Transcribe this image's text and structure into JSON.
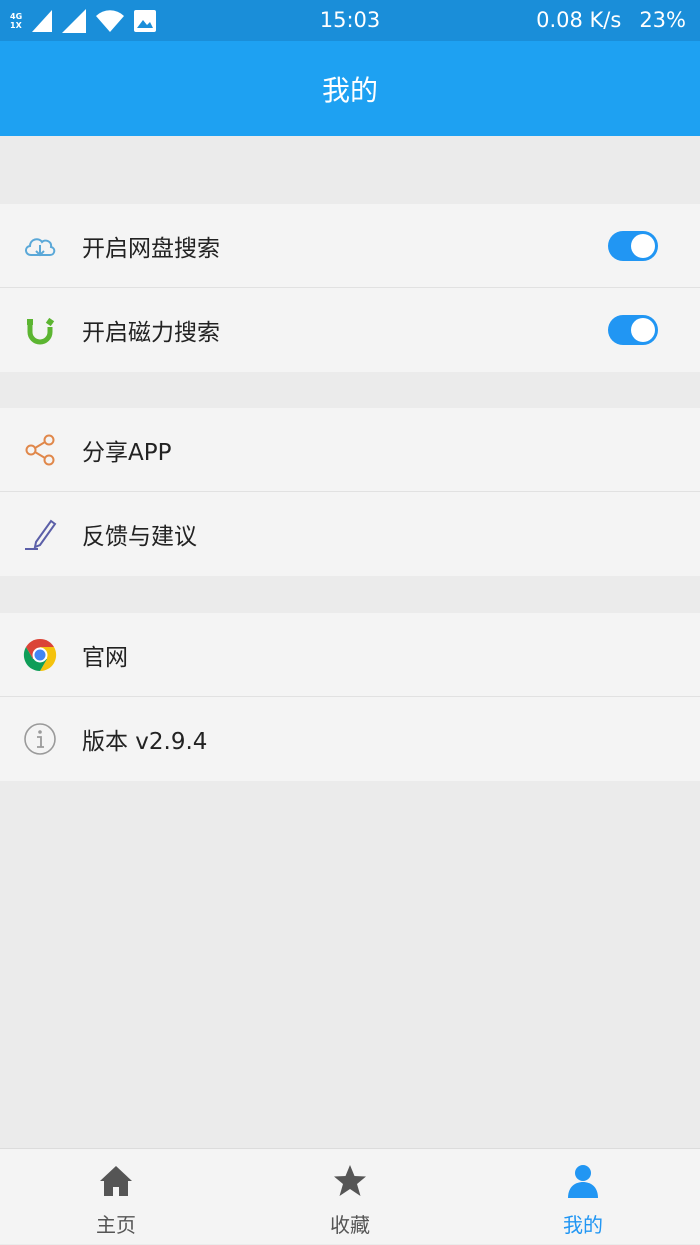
{
  "status_bar": {
    "network_top": "4G",
    "network_bottom": "1X",
    "time": "15:03",
    "speed": "0.08 K/s",
    "battery": "23%"
  },
  "header": {
    "title": "我的"
  },
  "sections": [
    {
      "items": [
        {
          "label": "开启网盘搜索",
          "icon": "cloud-download-icon",
          "toggle": true
        },
        {
          "label": "开启磁力搜索",
          "icon": "magnet-icon",
          "toggle": true
        }
      ]
    },
    {
      "items": [
        {
          "label": "分享APP",
          "icon": "share-icon"
        },
        {
          "label": "反馈与建议",
          "icon": "pencil-icon"
        }
      ]
    },
    {
      "items": [
        {
          "label": "官网",
          "icon": "chrome-icon"
        },
        {
          "label": "版本 v2.9.4",
          "icon": "info-icon"
        }
      ]
    }
  ],
  "bottom_nav": {
    "tabs": [
      {
        "label": "主页",
        "icon": "home-icon"
      },
      {
        "label": "收藏",
        "icon": "star-icon"
      },
      {
        "label": "我的",
        "icon": "person-icon",
        "active": true
      }
    ]
  },
  "colors": {
    "status_bar": "#1a8ed9",
    "header": "#1ea1f2",
    "accent": "#2196f3"
  }
}
